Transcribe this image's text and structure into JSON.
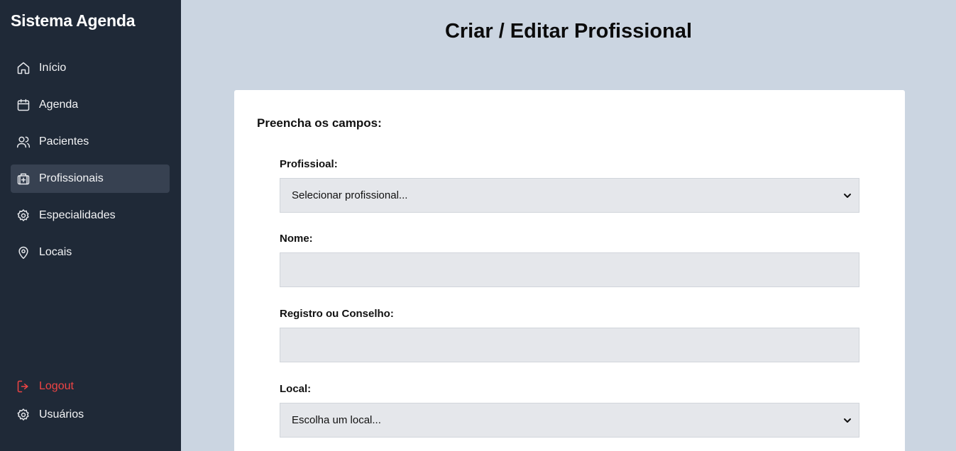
{
  "sidebar": {
    "brand": "Sistema Agenda",
    "items": [
      {
        "label": "Início",
        "icon": "home-icon"
      },
      {
        "label": "Agenda",
        "icon": "calendar-icon"
      },
      {
        "label": "Pacientes",
        "icon": "users-icon"
      },
      {
        "label": "Profissionais",
        "icon": "medical-bag-icon",
        "active": true
      },
      {
        "label": "Especialidades",
        "icon": "gear-icon"
      },
      {
        "label": "Locais",
        "icon": "map-pin-icon"
      }
    ],
    "logout_label": "Logout",
    "users_label": "Usuários"
  },
  "page": {
    "title": "Criar / Editar Profissional"
  },
  "form": {
    "heading": "Preencha os campos:",
    "profissional": {
      "label": "Profissioal:",
      "selected": "Selecionar profissional..."
    },
    "nome": {
      "label": "Nome:",
      "value": ""
    },
    "registro": {
      "label": "Registro ou Conselho:",
      "value": ""
    },
    "local": {
      "label": "Local:",
      "selected": "Escolha um local..."
    }
  },
  "colors": {
    "sidebar_bg": "#1f2937",
    "active_bg": "#374151",
    "main_bg": "#cbd5e1",
    "logout": "#ef4444",
    "input_bg": "#e5e7eb"
  }
}
